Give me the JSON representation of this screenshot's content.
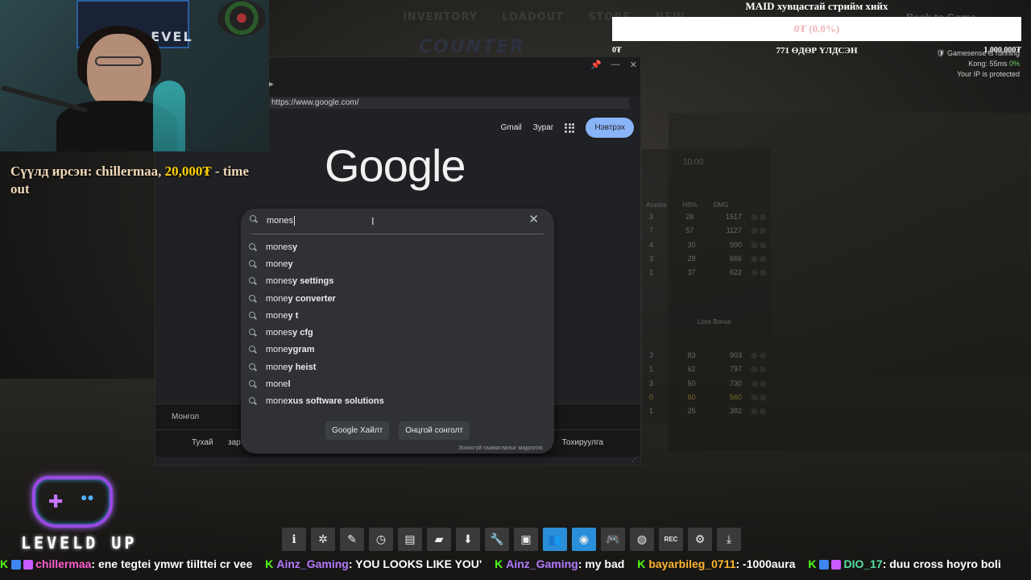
{
  "game": {
    "nav": [
      "INVENTORY",
      "LOADOUT",
      "STORE",
      "NEW"
    ],
    "logo": "COUNTER",
    "back_to_game": "Back to Game",
    "scoreboard": {
      "time": "10:00",
      "headers": [
        "Assists",
        "HS%",
        "DMG"
      ],
      "rows_top": [
        [
          "3",
          "28",
          "1517"
        ],
        [
          "7",
          "57",
          "1127"
        ],
        [
          "4",
          "30",
          "990"
        ],
        [
          "3",
          "28",
          "666"
        ],
        [
          "1",
          "37",
          "622"
        ]
      ],
      "loss_bonus": "Loss Bonus",
      "rows_bottom": [
        [
          "3",
          "83",
          "903"
        ],
        [
          "1",
          "62",
          "797"
        ],
        [
          "3",
          "50",
          "730"
        ],
        [
          "0",
          "60",
          "560"
        ],
        [
          "1",
          "25",
          "382"
        ]
      ]
    }
  },
  "browser": {
    "url": "https://www.google.com/",
    "header_links": [
      "Gmail",
      "Зураг"
    ],
    "sign_in": "Нэвтрэх",
    "logo": "Google",
    "search": {
      "query": "mones",
      "suggestions": [
        {
          "typed": "mones",
          "completion": "y"
        },
        {
          "typed": "mone",
          "completion": "y"
        },
        {
          "typed": "mones",
          "completion": "y settings"
        },
        {
          "typed": "mone",
          "completion": "y converter"
        },
        {
          "typed": "mone",
          "completion": "y t"
        },
        {
          "typed": "mones",
          "completion": "y cfg"
        },
        {
          "typed": "mone",
          "completion": "ygram"
        },
        {
          "typed": "mone",
          "completion": "y heist"
        },
        {
          "typed": "mone",
          "completion": "l"
        },
        {
          "typed": "mone",
          "completion": "xus software solutions"
        }
      ],
      "buttons": [
        "Google Хайлт",
        "Онцгой сонголт"
      ],
      "report": "Зохисгүй таамаглалыг мэдээлэх"
    },
    "footer": {
      "country": "Монгол",
      "links_left": [
        "Тухай",
        "зар"
      ],
      "links_right": [
        "Тохируулга"
      ]
    }
  },
  "overlay": {
    "alert": {
      "prefix": "Сүүлд ирсэн: ",
      "name": "chillermaa",
      "amount": "20,000₮",
      "suffix": " - time out"
    },
    "goal": {
      "title": "MAID хувцастай стрийм хийх",
      "percent_text": "0₮ (0.0%)",
      "progress": 0.0,
      "current": "0₮",
      "days_left": "771 ӨДӨР ҮЛДСЭН",
      "target": "1,000,000₮"
    },
    "network": {
      "gamesense": "Gamesense is running",
      "kong_label": "Kong:",
      "kong_ping": "55ms",
      "kong_loss": "0%",
      "ip": "Your IP is protected"
    },
    "logo_text": "LEVELD UP"
  },
  "toolbar": [
    "info",
    "gear-badge",
    "pencil",
    "history",
    "document",
    "chat",
    "download",
    "wrench",
    "image",
    "users",
    "compass",
    "gamepad",
    "globe",
    "rec",
    "settings",
    "minimize"
  ],
  "chat": [
    {
      "user": "chillermaa",
      "text": ": ene tegtei ymwr tiilttei cr vee",
      "color": "pink"
    },
    {
      "user": "Ainz_Gaming",
      "text": ": YOU LOOKS LIKE YOU'",
      "color": "purple"
    },
    {
      "user": "Ainz_Gaming",
      "text": ": my bad",
      "color": "purple"
    },
    {
      "user": "bayarbileg_0711",
      "text": ": -1000aura",
      "color": "orange"
    },
    {
      "user": "DIO_17",
      "text": ": duu cross hoyro boli",
      "color": "green"
    }
  ]
}
